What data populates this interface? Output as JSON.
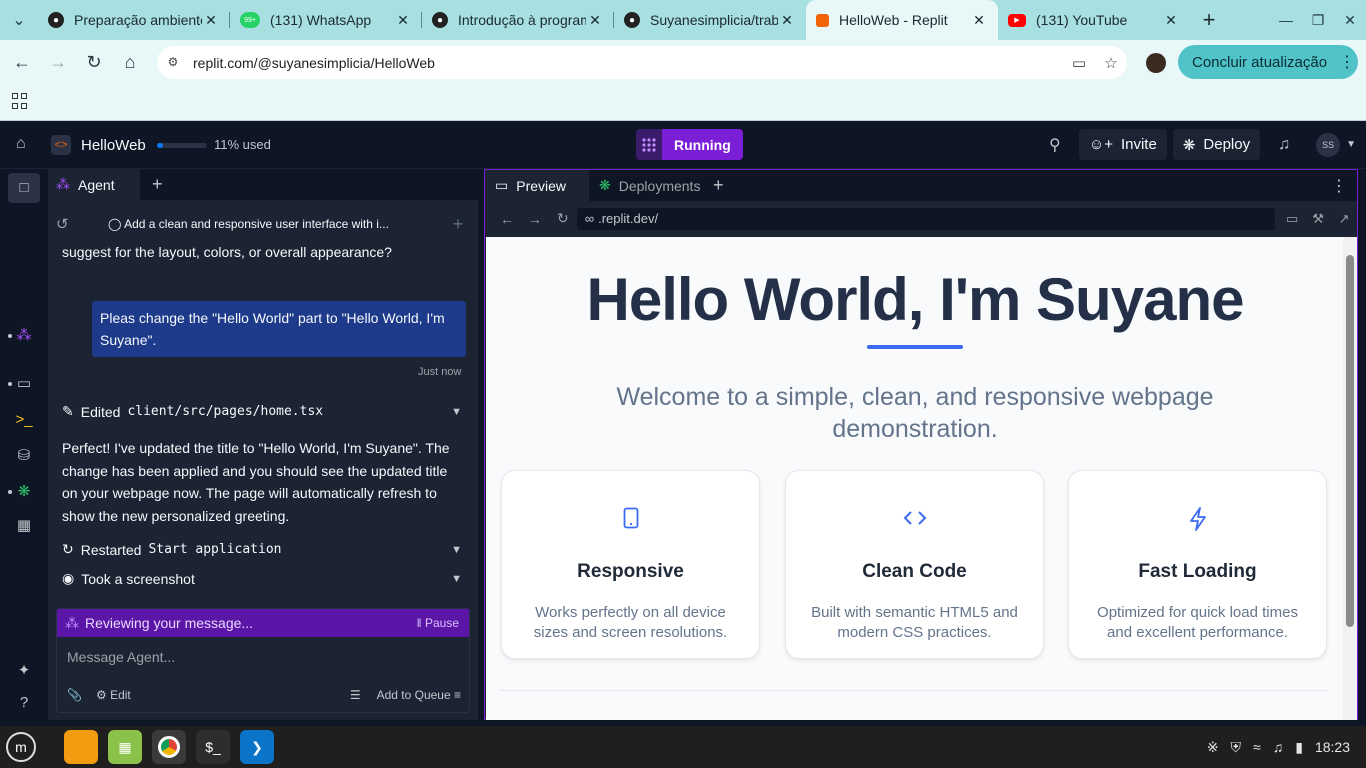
{
  "browser": {
    "tabs": [
      {
        "title": "Preparação ambiente",
        "favicon": "github-icon"
      },
      {
        "title": "(131) WhatsApp",
        "favicon": "whatsapp-icon"
      },
      {
        "title": "Introdução à program",
        "favicon": "github-icon"
      },
      {
        "title": "Suyanesimplicia/trab",
        "favicon": "github-icon"
      },
      {
        "title": "HelloWeb - Replit",
        "favicon": "replit-icon",
        "active": true
      },
      {
        "title": "(131) YouTube",
        "favicon": "youtube-icon"
      }
    ],
    "whatsapp_badge": "99+",
    "url": "replit.com/@suyanesimplicia/HelloWeb",
    "update_button": "Concluir atualização"
  },
  "replit": {
    "project_name": "HelloWeb",
    "usage_label": "11% used",
    "usage_percent": 11,
    "run_label": "Running",
    "invite_label": "Invite",
    "deploy_label": "Deploy",
    "avatar_initials": "SS"
  },
  "agent": {
    "tab_label": "Agent",
    "thread_title": "Add a clean and responsive user interface with i...",
    "prev_message": "suggest for the layout, colors, or overall appearance?",
    "user_message": "Pleas change the \"Hello World\" part to \"Hello World, I'm Suyane\".",
    "timestamp": "Just now",
    "action_edit_label": "Edited",
    "action_edit_file": "client/src/pages/home.tsx",
    "reply": "Perfect! I've updated the title to \"Hello World, I'm Suyane\". The change has been applied and you should see the updated title on your webpage now. The page will automatically refresh to show the new personalized greeting.",
    "action_restart_label": "Restarted",
    "action_restart_target": "Start application",
    "action_screenshot": "Took a screenshot",
    "status": "Reviewing your message...",
    "pause_label": "Pause",
    "input_placeholder": "Message Agent...",
    "edit_label": "Edit",
    "queue_label": "Add to Queue"
  },
  "preview": {
    "tab_preview": "Preview",
    "tab_deployments": "Deployments",
    "url": ".replit.dev/",
    "heading": "Hello World, I'm Suyane",
    "subtitle": "Welcome to a simple, clean, and responsive webpage demonstration.",
    "cards": [
      {
        "title": "Responsive",
        "desc": "Works perfectly on all device sizes and screen resolutions.",
        "icon": "smartphone-icon"
      },
      {
        "title": "Clean Code",
        "desc": "Built with semantic HTML5 and modern CSS practices.",
        "icon": "code-icon"
      },
      {
        "title": "Fast Loading",
        "desc": "Optimized for quick load times and excellent performance.",
        "icon": "lightning-icon"
      }
    ]
  },
  "taskbar": {
    "time": "18:23"
  },
  "colors": {
    "accent": "#7a1fd6",
    "link_blue": "#3b6cf0",
    "browser_chrome": "#a8dfe1"
  }
}
